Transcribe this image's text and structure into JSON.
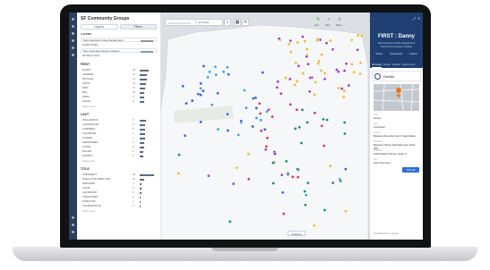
{
  "panel": {
    "title": "SF Community Groups",
    "tabs": [
      "Layers",
      "Filters"
    ],
    "layers_label": "LAYERS",
    "layers": [
      "San Francisco Police Department",
      "Public Profile",
      "San Francisco Group Location",
      "SF Metro Area"
    ],
    "groups": [
      {
        "heading": "FIRST",
        "rows": [
          {
            "label": "DANNY",
            "count": "18",
            "fill": 0.55
          },
          {
            "label": "ANDREW",
            "count": "14",
            "fill": 0.45
          },
          {
            "label": "MICHAEL",
            "count": "13",
            "fill": 0.42
          },
          {
            "label": "KEVIN",
            "count": "12",
            "fill": 0.38
          },
          {
            "label": "ERIC",
            "count": "11",
            "fill": 0.35
          },
          {
            "label": "BILL",
            "count": "10",
            "fill": 0.3
          },
          {
            "label": "MARK",
            "count": "9",
            "fill": 0.28
          },
          {
            "label": "JASON",
            "count": "8",
            "fill": 0.25
          }
        ],
        "more": "Show more"
      },
      {
        "heading": "LAST",
        "rows": [
          {
            "label": "WILLIAMSON",
            "count": "9",
            "fill": 0.4
          },
          {
            "label": "CHOWDHURY",
            "count": "8",
            "fill": 0.36
          },
          {
            "label": "CAMPBELL",
            "count": "8",
            "fill": 0.36
          },
          {
            "label": "CHANDLER",
            "count": "7",
            "fill": 0.32
          },
          {
            "label": "FLORES",
            "count": "7",
            "fill": 0.32
          },
          {
            "label": "HERNANDEZ",
            "count": "6",
            "fill": 0.28
          },
          {
            "label": "LOPEZ",
            "count": "6",
            "fill": 0.28
          },
          {
            "label": "MILLER",
            "count": "5",
            "fill": 0.24
          },
          {
            "label": "MORRIS",
            "count": "5",
            "fill": 0.24
          }
        ],
        "more": "Show more"
      },
      {
        "heading": "TITLE",
        "rows": [
          {
            "label": "PRESIDENT",
            "count": "46",
            "fill": 0.9
          },
          {
            "label": "EXECUTIVE DIRECTOR",
            "count": "10",
            "fill": 0.3
          },
          {
            "label": "MANAGER",
            "count": "4",
            "fill": 0.12
          },
          {
            "label": "CHAIR",
            "count": "3",
            "fill": 0.1
          },
          {
            "label": "SECRETARY",
            "count": "3",
            "fill": 0.1
          },
          {
            "label": "TREASURER",
            "count": "2",
            "fill": 0.08
          },
          {
            "label": "DIRECTOR",
            "count": "2",
            "fill": 0.08
          },
          {
            "label": "COORDINATOR",
            "count": "2",
            "fill": 0.08
          }
        ],
        "more": "Show more"
      }
    ]
  },
  "map": {
    "search_placeholder": "Search Groups for...",
    "search_scope": "All Fields",
    "drawing_label": "Drawing",
    "top_actions": [
      "Add",
      "Save",
      "Share"
    ],
    "marker_colors": [
      "#3b5bd6",
      "#e2b93b",
      "#9b3fc4",
      "#1d8a6a",
      "#d8345f",
      "#3aa0d8"
    ]
  },
  "card": {
    "name": "FIRST : Danny",
    "subtitle_1": "San Francisco Police Department",
    "subtitle_2": "Community Groups Location",
    "actions": [
      "Share",
      "Download",
      "Follow"
    ],
    "tabs": [
      "Summary",
      "Details",
      "Related",
      "Attachments"
    ],
    "details_title": "Details",
    "fields": [
      {
        "label": "First",
        "value": "Danny"
      },
      {
        "label": "Last",
        "value": "Campbell"
      },
      {
        "label": "Group",
        "value": "Bayview Development Organization"
      },
      {
        "label": "Address",
        "value": "Bayview Street Newhall Lane Suite 300"
      },
      {
        "label": "Location",
        "value": "1000 Market Street, Suite 6"
      },
      {
        "label": "City",
        "value": "San Francisco"
      }
    ],
    "view_all": "View all",
    "footer": "Feedback Form • Report"
  }
}
